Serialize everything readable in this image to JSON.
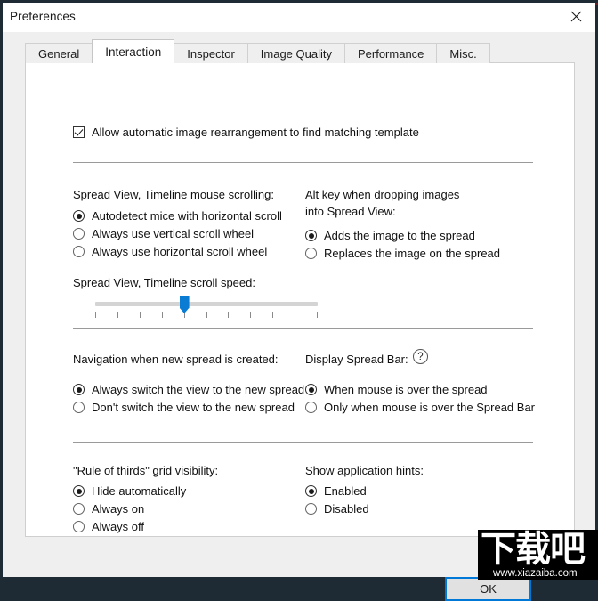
{
  "window": {
    "title": "Preferences",
    "close_icon": "close-icon"
  },
  "tabs": [
    {
      "label": "General",
      "selected": false
    },
    {
      "label": "Interaction",
      "selected": true
    },
    {
      "label": "Inspector",
      "selected": false
    },
    {
      "label": "Image Quality",
      "selected": false
    },
    {
      "label": "Performance",
      "selected": false
    },
    {
      "label": "Misc.",
      "selected": false
    }
  ],
  "content": {
    "auto_rearrange": {
      "label": "Allow automatic image rearrangement to find matching template",
      "checked": true
    },
    "scrolling": {
      "label": "Spread View, Timeline mouse scrolling:",
      "options": [
        {
          "label": "Autodetect mice with horizontal scroll",
          "selected": true
        },
        {
          "label": "Always use vertical scroll wheel",
          "selected": false
        },
        {
          "label": "Always use horizontal scroll wheel",
          "selected": false
        }
      ]
    },
    "alt_key": {
      "label_line1": "Alt key when dropping images",
      "label_line2": "into Spread View:",
      "options": [
        {
          "label": "Adds the image to the spread",
          "selected": true
        },
        {
          "label": "Replaces the image on the spread",
          "selected": false
        }
      ]
    },
    "scroll_speed": {
      "label": "Spread View, Timeline scroll speed:",
      "ticks": 11,
      "value": 4,
      "min": 0,
      "max": 10,
      "accent_color": "#0a7cd4"
    },
    "navigation": {
      "label": "Navigation when new spread is created:",
      "options": [
        {
          "label": "Always switch the view to the new spread",
          "selected": true
        },
        {
          "label": "Don't switch the view to the new spread",
          "selected": false
        }
      ]
    },
    "spread_bar": {
      "label": "Display Spread Bar:",
      "help_icon": "?",
      "options": [
        {
          "label": "When mouse is over the spread",
          "selected": true
        },
        {
          "label": "Only when mouse is over the Spread Bar",
          "selected": false
        }
      ]
    },
    "rule_of_thirds": {
      "label": "\"Rule of thirds\" grid visibility:",
      "options": [
        {
          "label": "Hide automatically",
          "selected": true
        },
        {
          "label": "Always on",
          "selected": false
        },
        {
          "label": "Always off",
          "selected": false
        }
      ]
    },
    "app_hints": {
      "label": "Show application hints:",
      "options": [
        {
          "label": "Enabled",
          "selected": true
        },
        {
          "label": "Disabled",
          "selected": false
        }
      ]
    }
  },
  "footer": {
    "ok_label": "OK"
  },
  "watermark": {
    "glyphs": "下载吧",
    "url": "www.xiazaiba.com"
  }
}
